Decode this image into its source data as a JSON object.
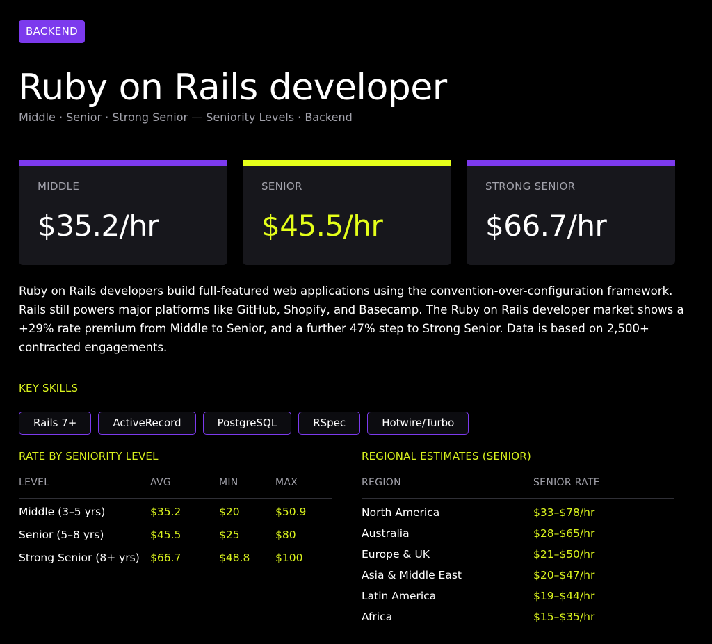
{
  "badge": "BACKEND",
  "title": "Ruby on Rails developer",
  "subtitle": "Middle · Senior · Strong Senior — Seniority Levels · Backend",
  "colors": {
    "accent_purple": "#7c3aed",
    "accent_lime": "#d9f21d",
    "card_bg": "#17171c"
  },
  "cards": [
    {
      "label": "MIDDLE",
      "value": "$35.2/hr",
      "bar_color": "#7c3aed",
      "value_color": "#ffffff"
    },
    {
      "label": "SENIOR",
      "value": "$45.5/hr",
      "bar_color": "#e5ff1a",
      "value_color": "#e5ff1a"
    },
    {
      "label": "STRONG SENIOR",
      "value": "$66.7/hr",
      "bar_color": "#7c3aed",
      "value_color": "#ffffff"
    }
  ],
  "description": "Ruby on Rails developers build full-featured web applications using the convention-over-configuration framework. Rails still powers major platforms like GitHub, Shopify, and Basecamp. The Ruby on Rails developer market shows a +29% rate premium from Middle to Senior, and a further 47% step to Strong Senior. Data is based on 2,500+ contracted engagements.",
  "skills": {
    "heading": "KEY SKILLS",
    "items": [
      "Rails 7+",
      "ActiveRecord",
      "PostgreSQL",
      "RSpec",
      "Hotwire/Turbo"
    ]
  },
  "seniority_table": {
    "heading": "RATE BY SENIORITY LEVEL",
    "columns": [
      "LEVEL",
      "AVG",
      "MIN",
      "MAX"
    ],
    "rows": [
      [
        "Middle (3–5 yrs)",
        "$35.2",
        "$20",
        "$50.9"
      ],
      [
        "Senior (5–8 yrs)",
        "$45.5",
        "$25",
        "$80"
      ],
      [
        "Strong Senior (8+ yrs)",
        "$66.7",
        "$48.8",
        "$100"
      ]
    ]
  },
  "regional_table": {
    "heading": "REGIONAL ESTIMATES (SENIOR)",
    "columns": [
      "REGION",
      "SENIOR RATE"
    ],
    "rows": [
      [
        "North America",
        "$33–$78/hr"
      ],
      [
        "Australia",
        "$28–$65/hr"
      ],
      [
        "Europe & UK",
        "$21–$50/hr"
      ],
      [
        "Asia & Middle East",
        "$20–$47/hr"
      ],
      [
        "Latin America",
        "$19–$44/hr"
      ],
      [
        "Africa",
        "$15–$35/hr"
      ]
    ]
  }
}
